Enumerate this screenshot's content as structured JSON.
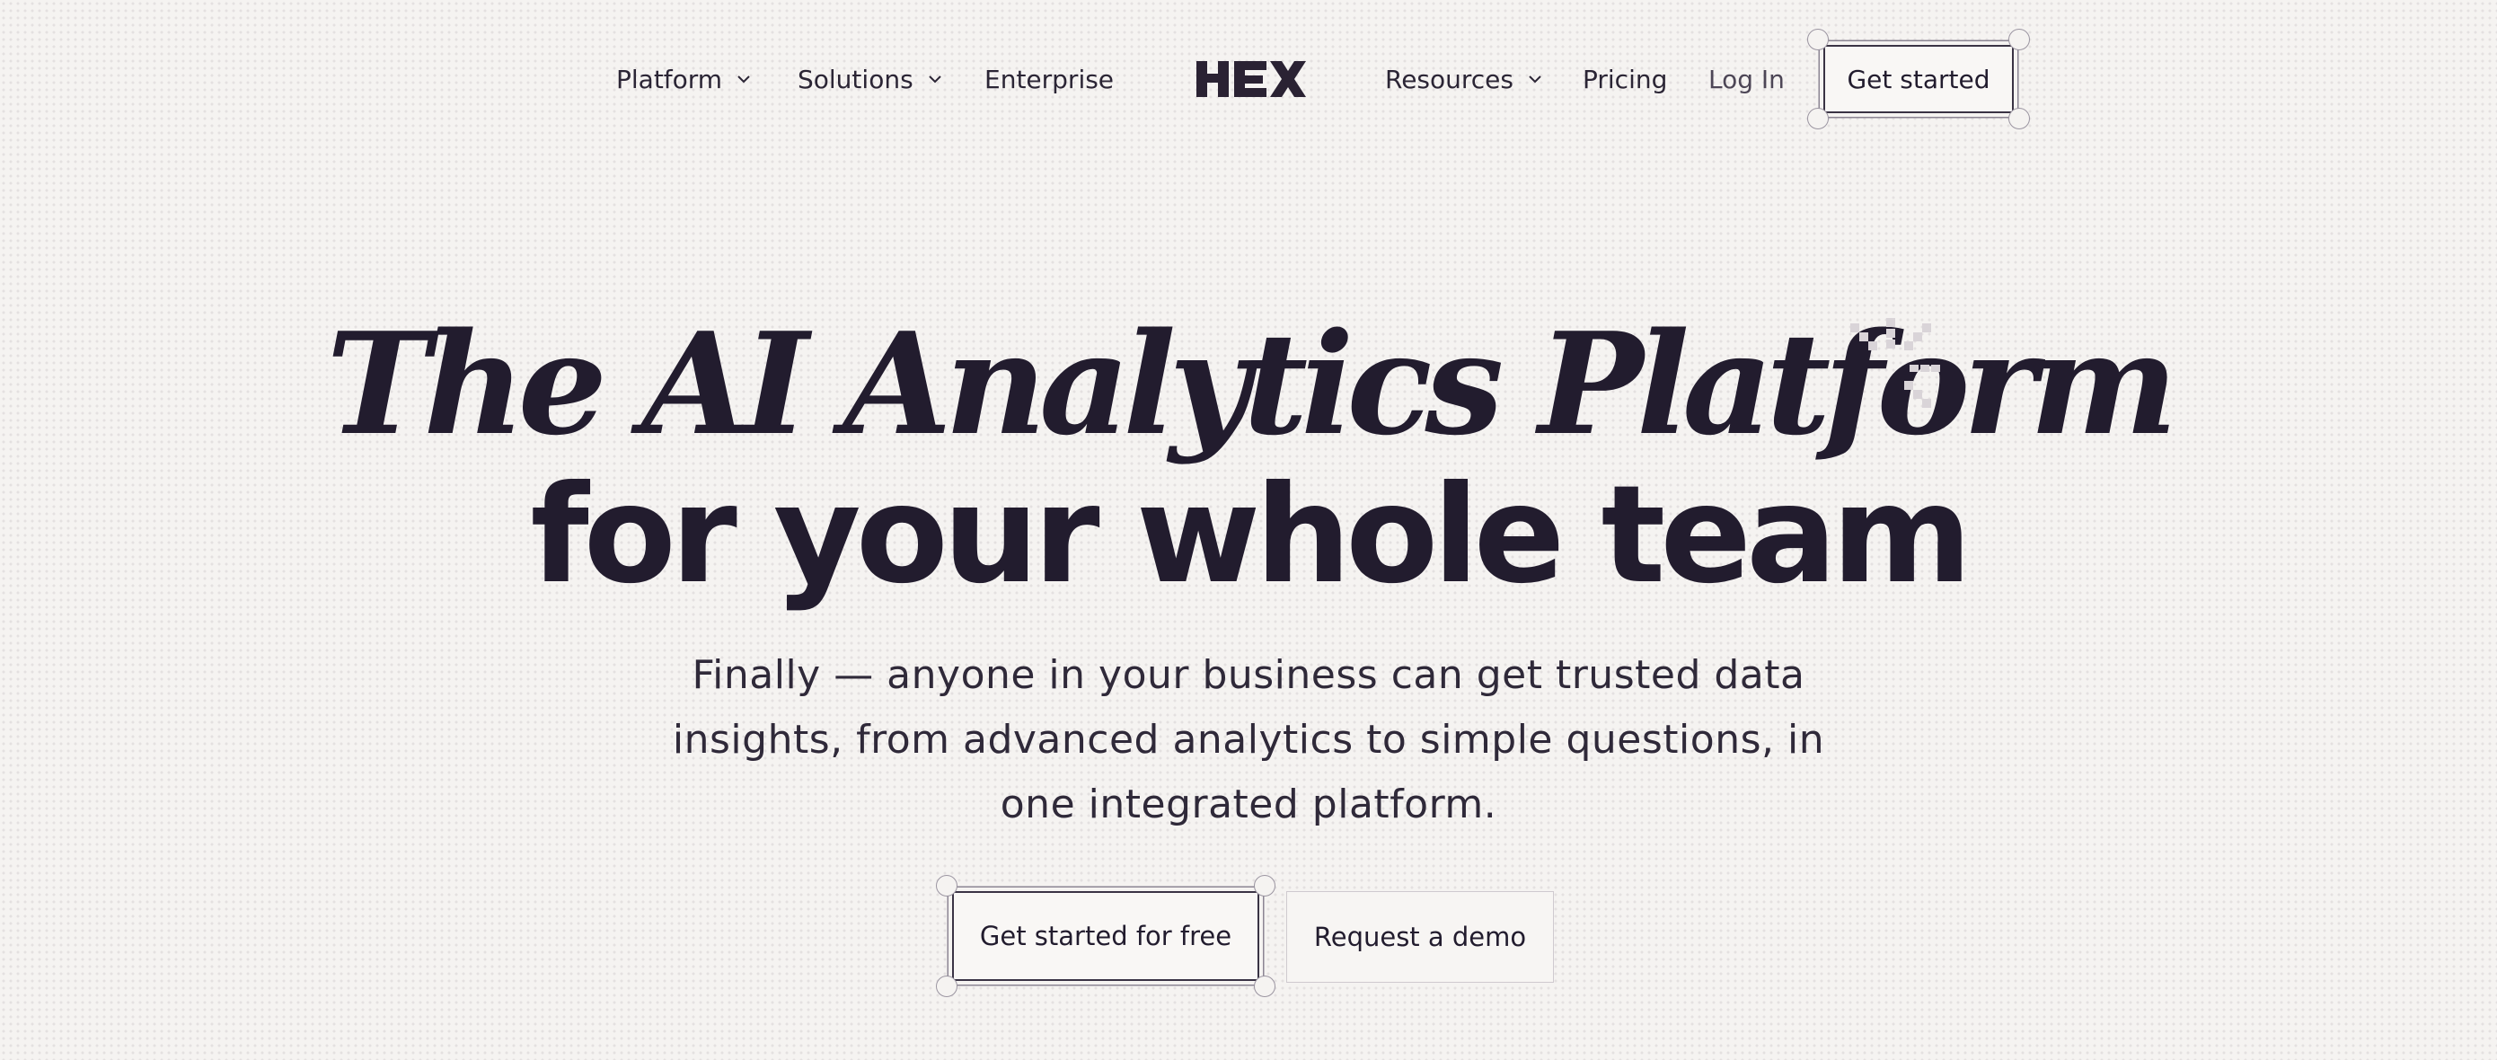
{
  "nav": {
    "left_items": [
      {
        "label": "Platform",
        "has_dropdown": true
      },
      {
        "label": "Solutions",
        "has_dropdown": true
      },
      {
        "label": "Enterprise",
        "has_dropdown": false
      }
    ],
    "right_items": [
      {
        "label": "Resources",
        "has_dropdown": true
      },
      {
        "label": "Pricing",
        "has_dropdown": false
      }
    ],
    "login_label": "Log In",
    "cta_label": "Get started",
    "logo_text": "HEX"
  },
  "hero": {
    "title_line1": "The AI Analytics Platform",
    "title_line2": "for your whole team",
    "subtitle_lines": [
      "Finally — anyone in your business can get trusted data",
      "insights, from advanced analytics to simple questions, in",
      "one integrated platform."
    ],
    "primary_cta": "Get started for free",
    "secondary_cta": "Request a demo"
  },
  "icons": {
    "chevron": "chevron-down-icon",
    "sparkle": "sparkle-icon"
  },
  "colors": {
    "background": "#f5f3f1",
    "text": "#221c2e",
    "border": "#3a3344"
  }
}
